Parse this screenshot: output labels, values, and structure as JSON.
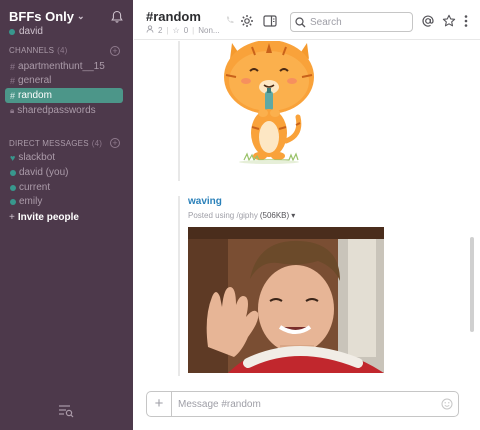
{
  "team": {
    "name": "BFFs Only",
    "user": "david"
  },
  "channels": {
    "title": "CHANNELS",
    "count": "(4)",
    "items": [
      {
        "label": "apartmenthunt__15",
        "prefix": "#"
      },
      {
        "label": "general",
        "prefix": "#"
      },
      {
        "label": "random",
        "prefix": "#",
        "active": true
      },
      {
        "label": "sharedpasswords",
        "prefix": "lock"
      }
    ]
  },
  "dms": {
    "title": "DIRECT MESSAGES",
    "count": "(4)",
    "items": [
      {
        "label": "slackbot"
      },
      {
        "label": "david (you)"
      },
      {
        "label": "current"
      },
      {
        "label": "emily"
      }
    ]
  },
  "invite": {
    "label": "Invite people"
  },
  "header": {
    "title": "#random",
    "members": "2",
    "pins": "0",
    "topic": "Non..."
  },
  "search": {
    "placeholder": "Search"
  },
  "message": {
    "attachment_title": "waving",
    "posted_using": "Posted using /giphy",
    "size": "(506KB)"
  },
  "composer": {
    "placeholder": "Message #random",
    "plus": "+"
  },
  "colors": {
    "sidebar": "#4d394b",
    "active_channel": "#4c9689",
    "presence": "#38978d",
    "link": "#2a80b9"
  }
}
